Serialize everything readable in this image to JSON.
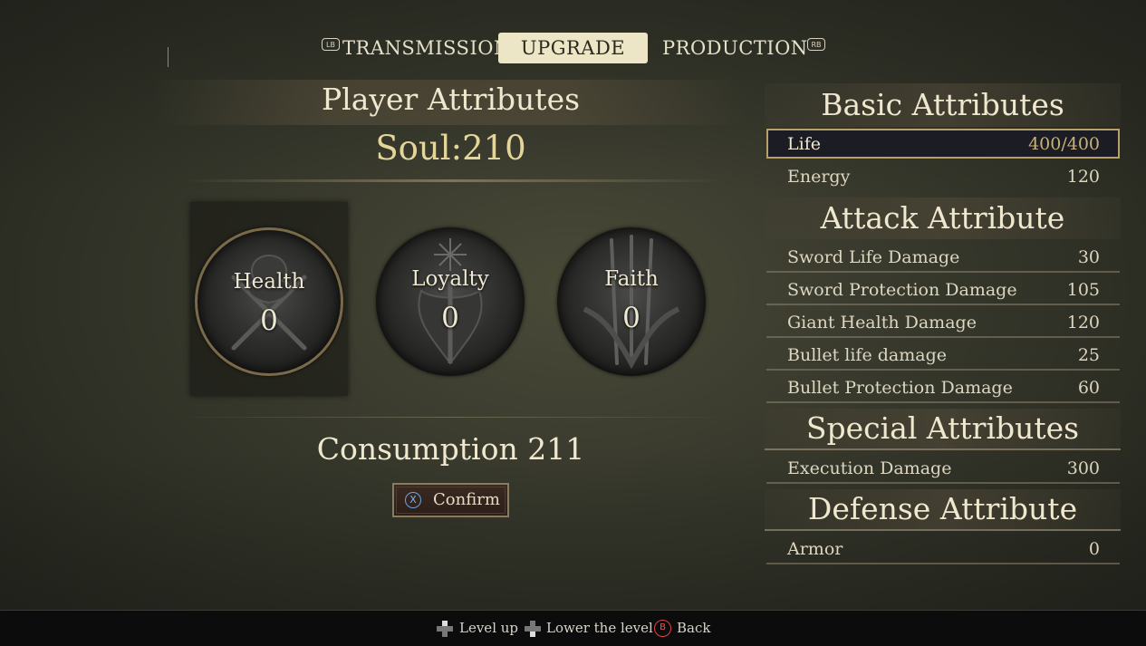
{
  "tabs": {
    "left_bumper": "LB",
    "right_bumper": "RB",
    "items": [
      {
        "label": "TRANSMISSION"
      },
      {
        "label": "UPGRADE",
        "active": true
      },
      {
        "label": "PRODUCTION"
      }
    ]
  },
  "player": {
    "title": "Player Attributes",
    "soul": "Soul:210",
    "attributes": [
      {
        "label": "Health",
        "value": "0",
        "icon": "health-crest-icon",
        "selected": true
      },
      {
        "label": "Loyalty",
        "value": "0",
        "icon": "loyalty-crest-icon"
      },
      {
        "label": "Faith",
        "value": "0",
        "icon": "faith-crest-icon"
      }
    ],
    "consumption": "Consumption 211",
    "confirm": {
      "button_glyph": "X",
      "label": "Confirm"
    }
  },
  "basic": {
    "title": "Basic Attributes",
    "rows": [
      {
        "label": "Life",
        "value": "400/400"
      },
      {
        "label": "Energy",
        "value": "120"
      }
    ]
  },
  "attack": {
    "title": "Attack Attribute",
    "rows": [
      {
        "label": "Sword Life Damage",
        "value": "30"
      },
      {
        "label": "Sword Protection Damage",
        "value": "105"
      },
      {
        "label": "Giant Health Damage",
        "value": "120"
      },
      {
        "label": "Bullet life damage",
        "value": "25"
      },
      {
        "label": "Bullet Protection Damage",
        "value": "60"
      }
    ]
  },
  "special": {
    "title": "Special Attributes",
    "rows": [
      {
        "label": "Execution Damage",
        "value": "300"
      }
    ]
  },
  "defense": {
    "title": "Defense Attribute",
    "rows": [
      {
        "label": "Armor",
        "value": "0"
      }
    ]
  },
  "footer": {
    "level_up": "Level up",
    "lower_level": "Lower the level",
    "back_glyph": "B",
    "back": "Back"
  },
  "colors": {
    "accent_gold": "#e4d59a",
    "selection_border": "#b8a06a",
    "tab_active_bg": "#ece6c6",
    "back_button": "#dd4444",
    "confirm_x": "#6aa4e0"
  }
}
